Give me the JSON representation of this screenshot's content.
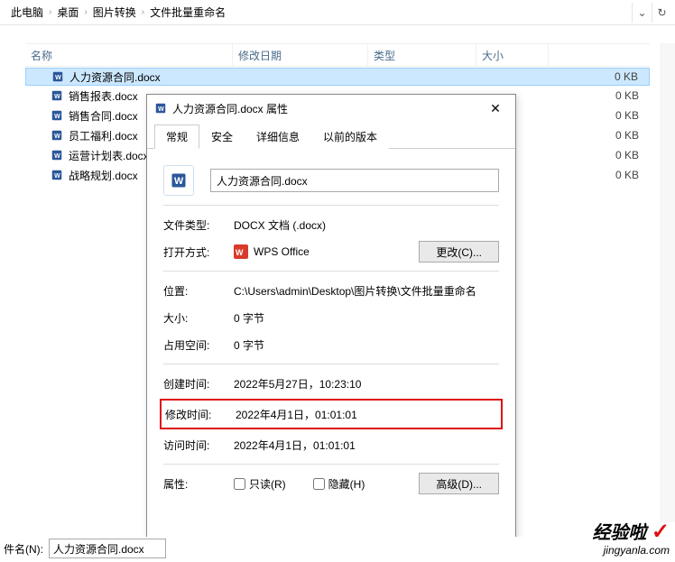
{
  "breadcrumb": {
    "items": [
      "此电脑",
      "桌面",
      "图片转换",
      "文件批量重命名"
    ]
  },
  "columns": {
    "name": "名称",
    "date": "修改日期",
    "type": "类型",
    "size": "大小"
  },
  "files": [
    {
      "name": "人力资源合同.docx",
      "size": "0 KB",
      "selected": true
    },
    {
      "name": "销售报表.docx",
      "size": "0 KB"
    },
    {
      "name": "销售合同.docx",
      "size": "0 KB"
    },
    {
      "name": "员工福利.docx",
      "size": "0 KB"
    },
    {
      "name": "运营计划表.docx",
      "size": "0 KB"
    },
    {
      "name": "战略规划.docx",
      "size": "0 KB"
    }
  ],
  "dialog": {
    "title": "人力资源合同.docx 属性",
    "tabs": [
      "常规",
      "安全",
      "详细信息",
      "以前的版本"
    ],
    "filename": "人力资源合同.docx",
    "labels": {
      "filetype": "文件类型:",
      "openwith": "打开方式:",
      "location": "位置:",
      "size": "大小:",
      "sizeOnDisk": "占用空间:",
      "created": "创建时间:",
      "modified": "修改时间:",
      "accessed": "访问时间:",
      "attributes": "属性:"
    },
    "values": {
      "filetype": "DOCX 文档 (.docx)",
      "openwith": "WPS Office",
      "changeBtn": "更改(C)...",
      "location": "C:\\Users\\admin\\Desktop\\图片转换\\文件批量重命名",
      "size": "0 字节",
      "sizeOnDisk": "0 字节",
      "created": "2022年5月27日，10:23:10",
      "modified": "2022年4月1日，01:01:01",
      "accessed": "2022年4月1日，01:01:01",
      "readonly": "只读(R)",
      "hidden": "隐藏(H)",
      "advancedBtn": "高级(D)..."
    }
  },
  "bottom": {
    "label": "件名(N):",
    "value": "人力资源合同.docx"
  },
  "watermark": {
    "line1": "经验啦",
    "line2": "jingyanla.com"
  }
}
